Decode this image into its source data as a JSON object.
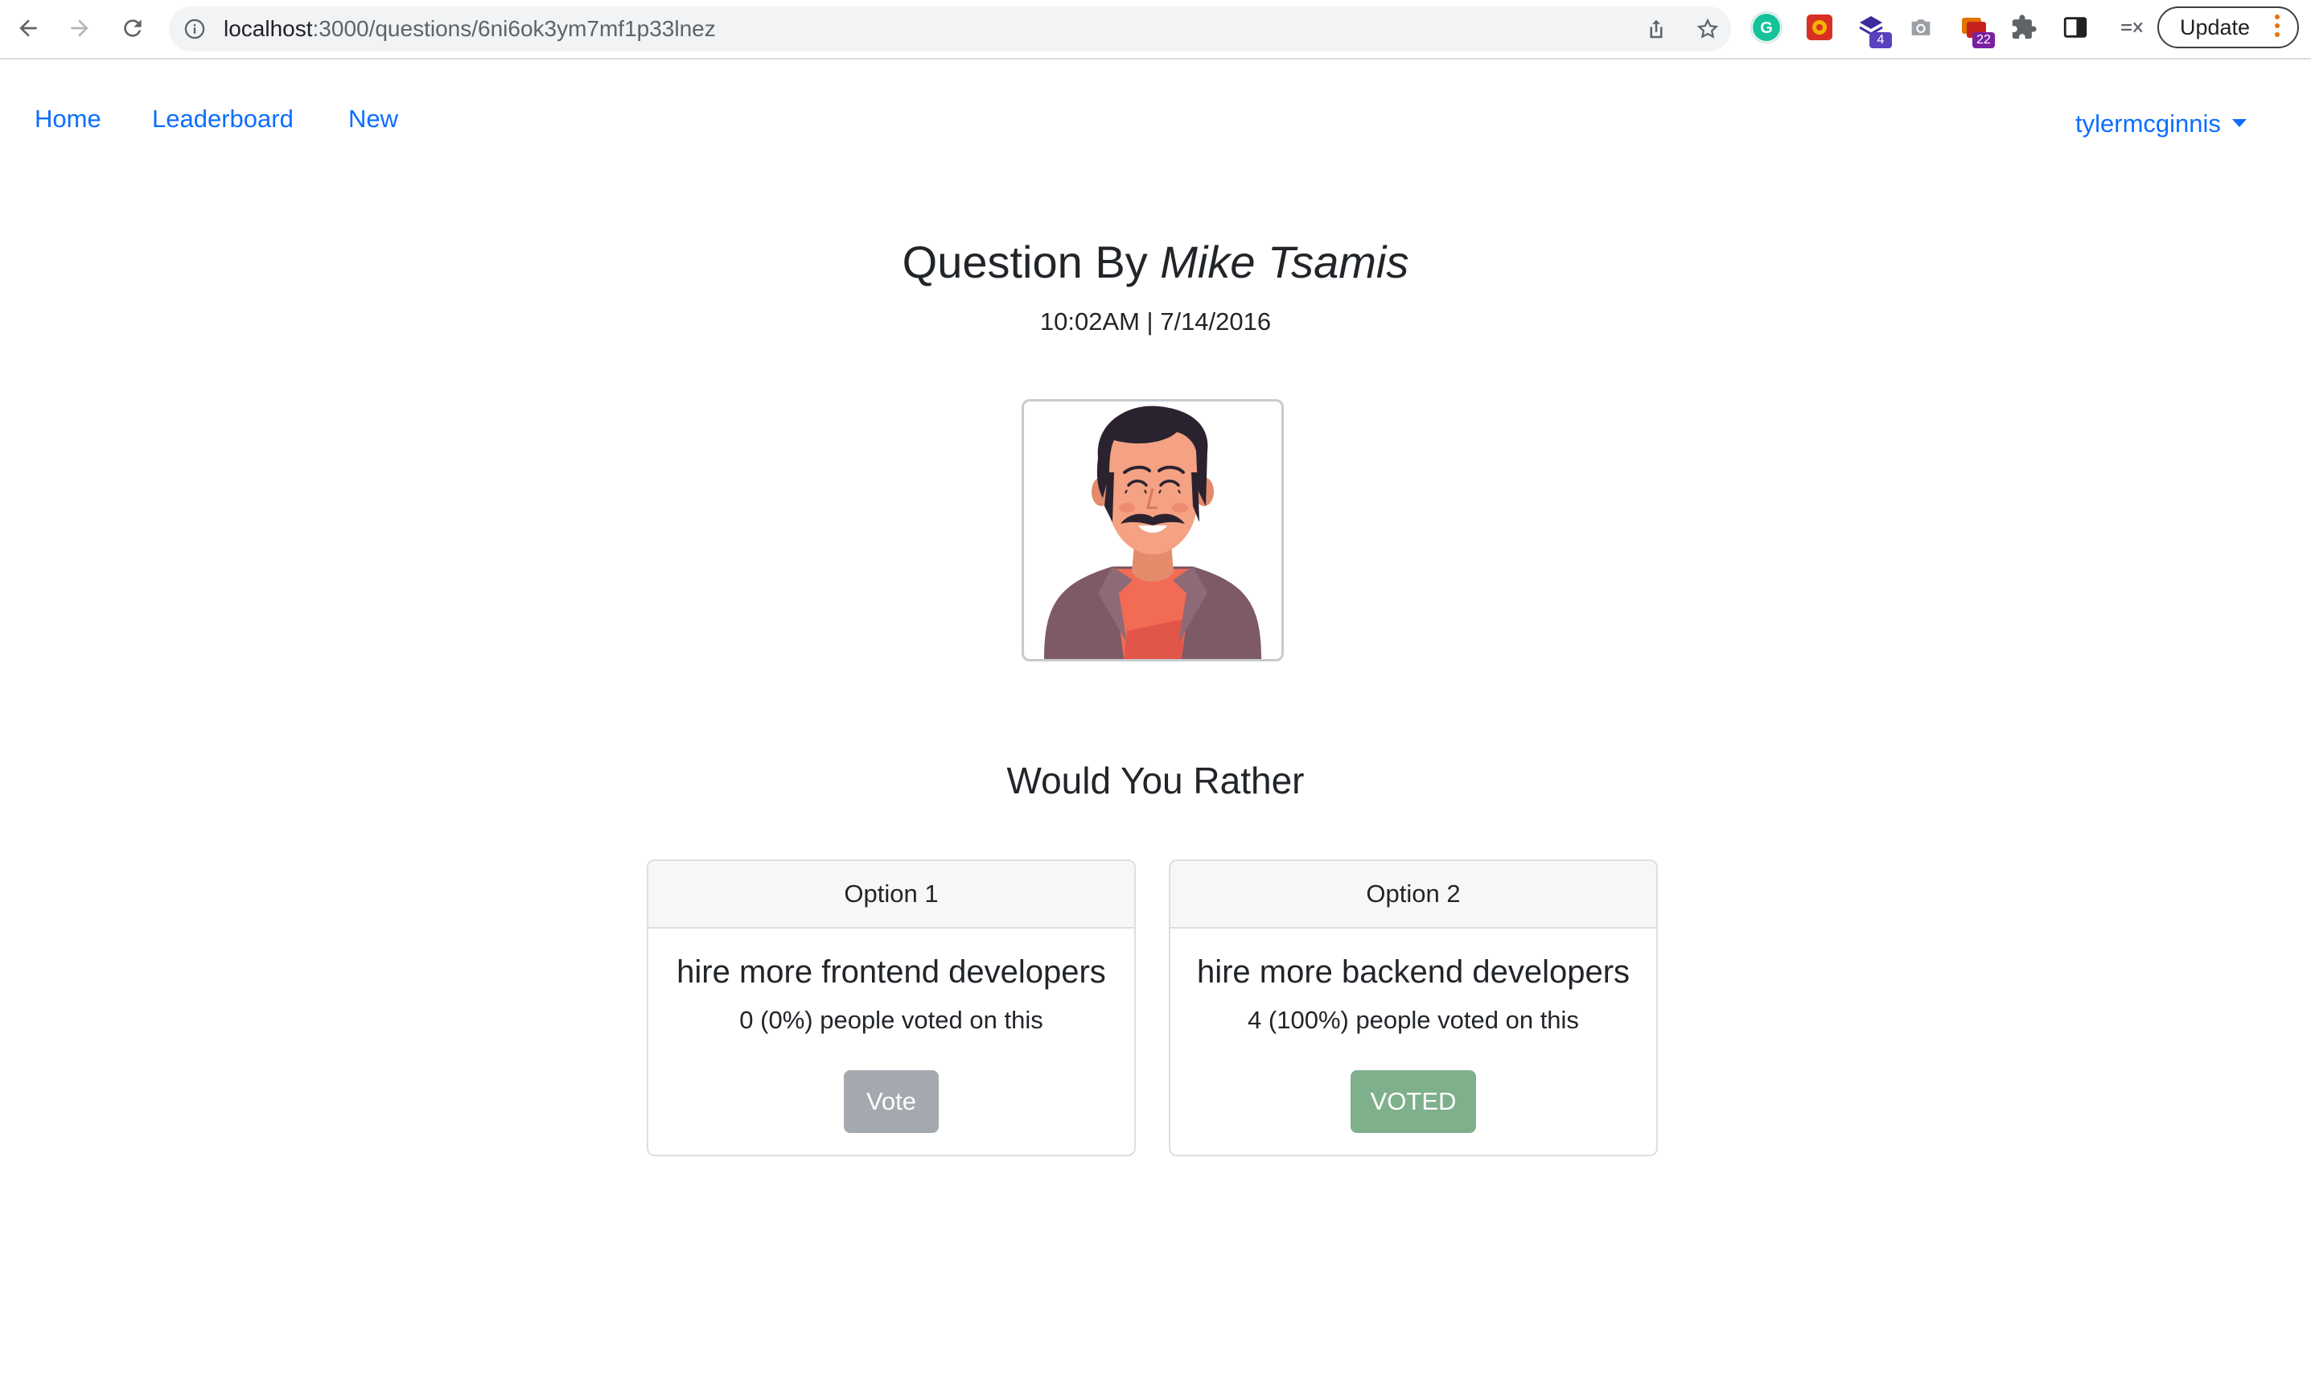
{
  "browser": {
    "url_host": "localhost",
    "url_path": ":3000/questions/6ni6ok3ym7mf1p33lnez",
    "update_label": "Update",
    "ext_badges": {
      "ext3": "4",
      "ext5": "22"
    },
    "colors": {
      "omnibox": "#f1f3f4",
      "badge_ext3": "#5a3fc0",
      "badge_ext5": "#7b1fa2"
    }
  },
  "nav": {
    "links": [
      "Home",
      "Leaderboard",
      "New"
    ],
    "user": "tylermcginnis",
    "link_color": "#0d6efd"
  },
  "question": {
    "title_prefix": "Question By ",
    "author": "Mike Tsamis",
    "timestamp": "10:02AM | 7/14/2016",
    "subtitle": "Would You Rather"
  },
  "options": [
    {
      "header": "Option 1",
      "text": "hire more frontend developers",
      "votes": "0 (0%) people voted on this",
      "button": "Vote",
      "button_color": "#a3a9ae"
    },
    {
      "header": "Option 2",
      "text": "hire more backend developers",
      "votes": "4 (100%) people voted on this",
      "button": "VOTED",
      "button_color": "#7fb08c"
    }
  ]
}
